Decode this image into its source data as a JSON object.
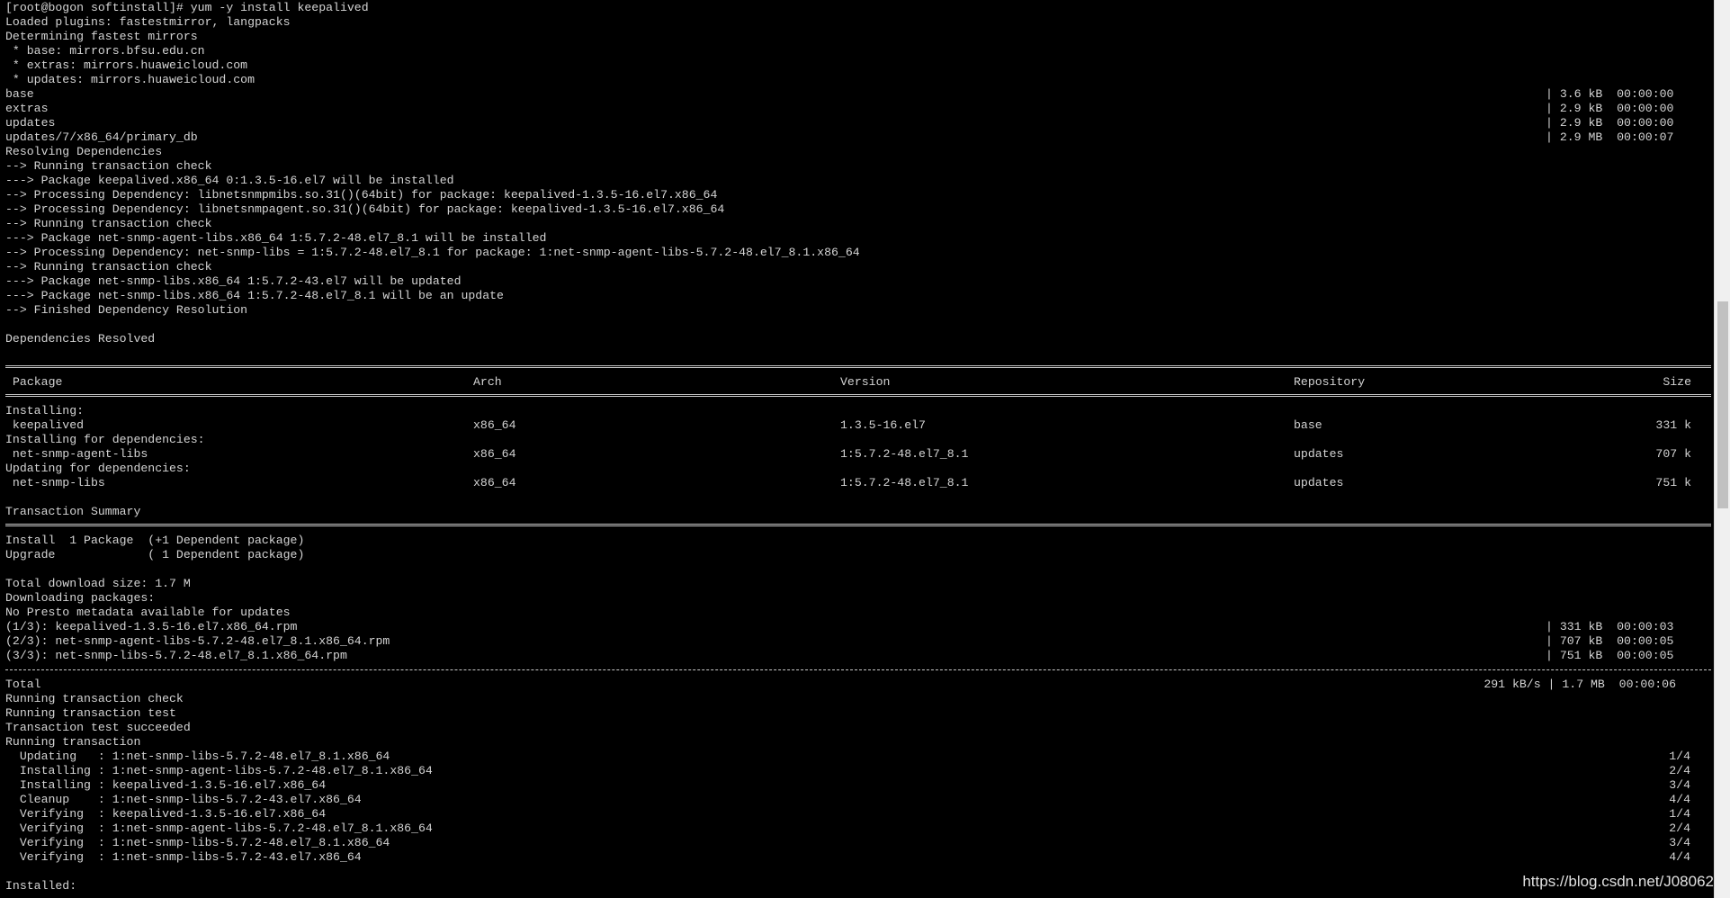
{
  "terminal": {
    "lines": [
      "[root@bogon softinstall]# yum -y install keepalived",
      "Loaded plugins: fastestmirror, langpacks",
      "Determining fastest mirrors",
      " * base: mirrors.bfsu.edu.cn",
      " * extras: mirrors.huaweicloud.com",
      " * updates: mirrors.huaweicloud.com",
      "base",
      "extras",
      "updates",
      "updates/7/x86_64/primary_db",
      "Resolving Dependencies",
      "--> Running transaction check",
      "---> Package keepalived.x86_64 0:1.3.5-16.el7 will be installed",
      "--> Processing Dependency: libnetsnmpmibs.so.31()(64bit) for package: keepalived-1.3.5-16.el7.x86_64",
      "--> Processing Dependency: libnetsnmpagent.so.31()(64bit) for package: keepalived-1.3.5-16.el7.x86_64",
      "--> Running transaction check",
      "---> Package net-snmp-agent-libs.x86_64 1:5.7.2-48.el7_8.1 will be installed",
      "--> Processing Dependency: net-snmp-libs = 1:5.7.2-48.el7_8.1 for package: 1:net-snmp-agent-libs-5.7.2-48.el7_8.1.x86_64",
      "--> Running transaction check",
      "---> Package net-snmp-libs.x86_64 1:5.7.2-43.el7 will be updated",
      "---> Package net-snmp-libs.x86_64 1:5.7.2-48.el7_8.1 will be an update",
      "--> Finished Dependency Resolution",
      "",
      "Dependencies Resolved"
    ],
    "repo_stats": [
      {
        "text": "| 3.6 kB  00:00:00"
      },
      {
        "text": "| 2.9 kB  00:00:00"
      },
      {
        "text": "| 2.9 kB  00:00:00"
      },
      {
        "text": "| 2.9 MB  00:00:07"
      }
    ],
    "table": {
      "headers": {
        "package": "Package",
        "arch": "Arch",
        "version": "Version",
        "repository": "Repository",
        "size": "Size"
      },
      "groups": [
        {
          "label": "Installing:",
          "row": {
            "package": " keepalived",
            "arch": "x86_64",
            "version": "1.3.5-16.el7",
            "repository": "base",
            "size": "331 k"
          }
        },
        {
          "label": "Installing for dependencies:",
          "row": {
            "package": " net-snmp-agent-libs",
            "arch": "x86_64",
            "version": "1:5.7.2-48.el7_8.1",
            "repository": "updates",
            "size": "707 k"
          }
        },
        {
          "label": "Updating for dependencies:",
          "row": {
            "package": " net-snmp-libs",
            "arch": "x86_64",
            "version": "1:5.7.2-48.el7_8.1",
            "repository": "updates",
            "size": "751 k"
          }
        }
      ]
    },
    "summary_title": "Transaction Summary",
    "summary_lines": [
      "Install  1 Package  (+1 Dependent package)",
      "Upgrade             ( 1 Dependent package)",
      "",
      "Total download size: 1.7 M",
      "Downloading packages:",
      "No Presto metadata available for updates",
      "(1/3): keepalived-1.3.5-16.el7.x86_64.rpm",
      "(2/3): net-snmp-agent-libs-5.7.2-48.el7_8.1.x86_64.rpm",
      "(3/3): net-snmp-libs-5.7.2-48.el7_8.1.x86_64.rpm"
    ],
    "download_stats": [
      {
        "text": "| 331 kB  00:00:03"
      },
      {
        "text": "| 707 kB  00:00:05"
      },
      {
        "text": "| 751 kB  00:00:05"
      }
    ],
    "total": {
      "label": "Total",
      "stats": "291 kB/s | 1.7 MB  00:00:06"
    },
    "transaction_lines": [
      "Running transaction check",
      "Running transaction test",
      "Transaction test succeeded",
      "Running transaction"
    ],
    "steps": [
      {
        "text": "  Updating   : 1:net-snmp-libs-5.7.2-48.el7_8.1.x86_64",
        "count": "1/4"
      },
      {
        "text": "  Installing : 1:net-snmp-agent-libs-5.7.2-48.el7_8.1.x86_64",
        "count": "2/4"
      },
      {
        "text": "  Installing : keepalived-1.3.5-16.el7.x86_64",
        "count": "3/4"
      },
      {
        "text": "  Cleanup    : 1:net-snmp-libs-5.7.2-43.el7.x86_64",
        "count": "4/4"
      },
      {
        "text": "  Verifying  : keepalived-1.3.5-16.el7.x86_64",
        "count": "1/4"
      },
      {
        "text": "  Verifying  : 1:net-snmp-agent-libs-5.7.2-48.el7_8.1.x86_64",
        "count": "2/4"
      },
      {
        "text": "  Verifying  : 1:net-snmp-libs-5.7.2-48.el7_8.1.x86_64",
        "count": "3/4"
      },
      {
        "text": "  Verifying  : 1:net-snmp-libs-5.7.2-43.el7.x86_64",
        "count": "4/4"
      }
    ],
    "installed_label": "Installed:"
  },
  "watermark": "https://blog.csdn.net/J08062",
  "colors": {
    "background": "#000000",
    "text": "#d4d4d4"
  }
}
